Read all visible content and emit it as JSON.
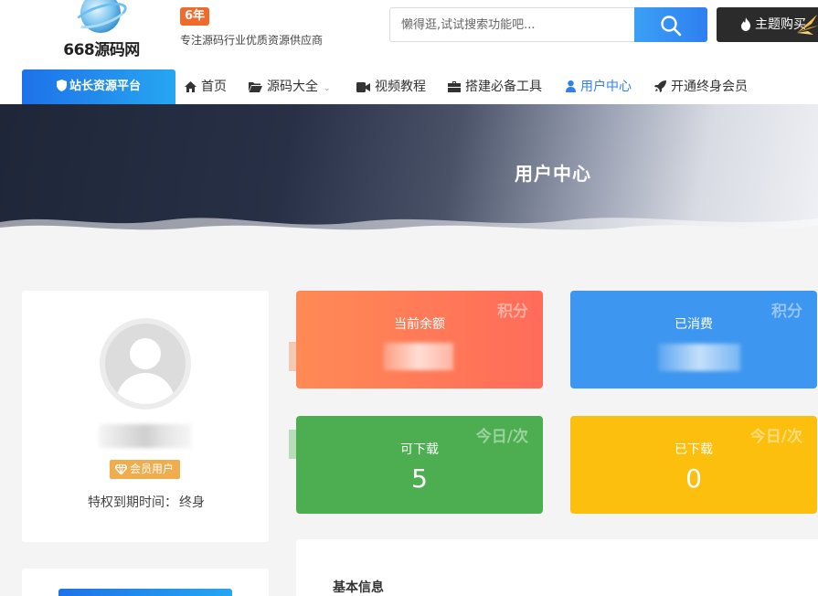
{
  "header": {
    "logo_text": "668源码网",
    "years_badge": "6年",
    "slogan": "专注源码行业优质资源供应商",
    "search_placeholder": "懒得逛,试试搜索功能吧...",
    "buy_label": "主题购买"
  },
  "nav": {
    "primary": "站长资源平台",
    "items": [
      {
        "label": "首页",
        "icon": "home-icon"
      },
      {
        "label": "源码大全",
        "icon": "folder-icon"
      },
      {
        "label": "视频教程",
        "icon": "video-icon"
      },
      {
        "label": "搭建必备工具",
        "icon": "briefcase-icon"
      },
      {
        "label": "用户中心",
        "icon": "user-icon"
      },
      {
        "label": "开通终身会员",
        "icon": "rocket-icon"
      }
    ]
  },
  "banner": {
    "title": "用户中心"
  },
  "profile": {
    "badge": "会员用户",
    "expire_label": "特权到期时间：",
    "expire_value": "终身"
  },
  "stats": [
    {
      "label": "当前余额",
      "corner": "积分",
      "value": ""
    },
    {
      "label": "已消费",
      "corner": "积分",
      "value": ""
    },
    {
      "label": "可下载",
      "corner": "今日/次",
      "value": "5"
    },
    {
      "label": "已下载",
      "corner": "今日/次",
      "value": "0"
    }
  ],
  "info": {
    "title": "基本信息"
  },
  "colors": {
    "accent": "#2f7ff0",
    "balance_card": "#ff7a58",
    "spent_card": "#3d96ef",
    "downloadable_card": "#4cae50",
    "downloaded_card": "#fcbf0d",
    "badge": "#f06a2c",
    "vip": "#f0ad4e"
  }
}
